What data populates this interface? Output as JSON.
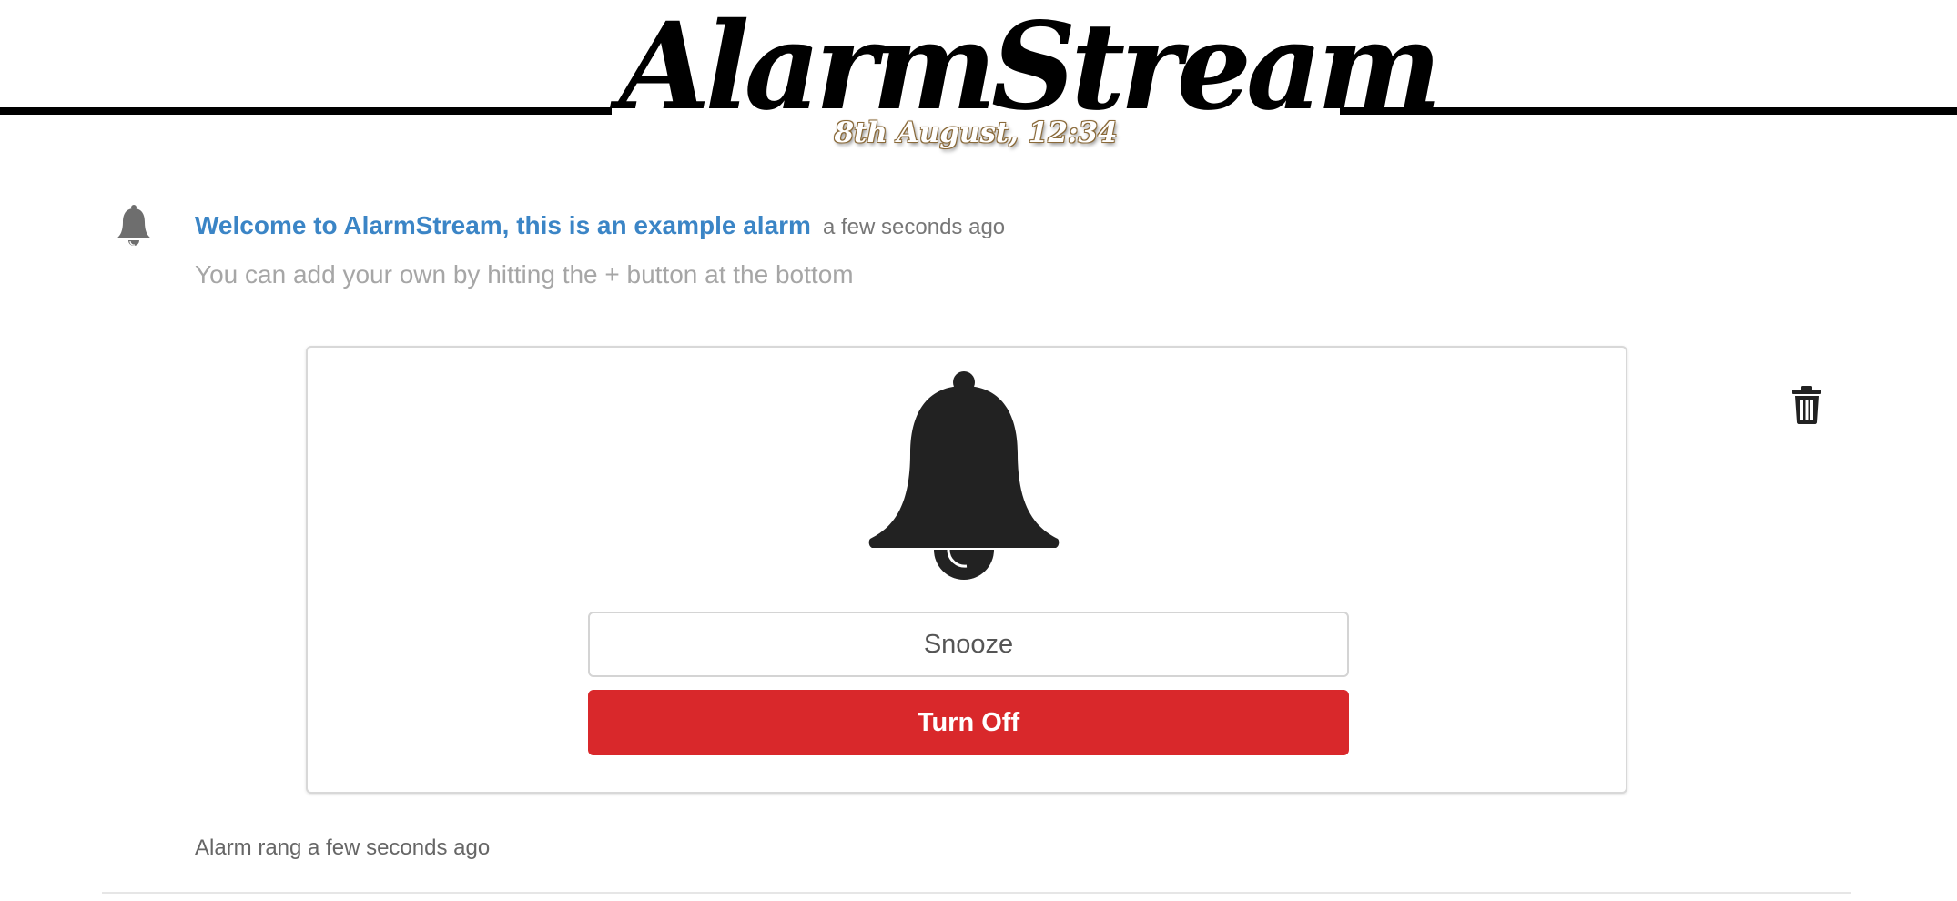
{
  "header": {
    "app_title": "AlarmStream",
    "date_time": "8th August, 12:34"
  },
  "alarm": {
    "icon": "bell-icon",
    "title": "Welcome to AlarmStream, this is an example alarm",
    "time_ago": "a few seconds ago",
    "description": "You can add your own by hitting the + button at the bottom",
    "ringing": {
      "icon": "bell-icon",
      "snooze_label": "Snooze",
      "turn_off_label": "Turn Off",
      "turn_off_color": "#d9282b"
    },
    "delete_icon": "trash-icon",
    "rang_text": "Alarm rang a few seconds ago"
  },
  "colors": {
    "accent": "#3b85c6",
    "muted": "#a6a6a6",
    "danger": "#d9282b"
  }
}
